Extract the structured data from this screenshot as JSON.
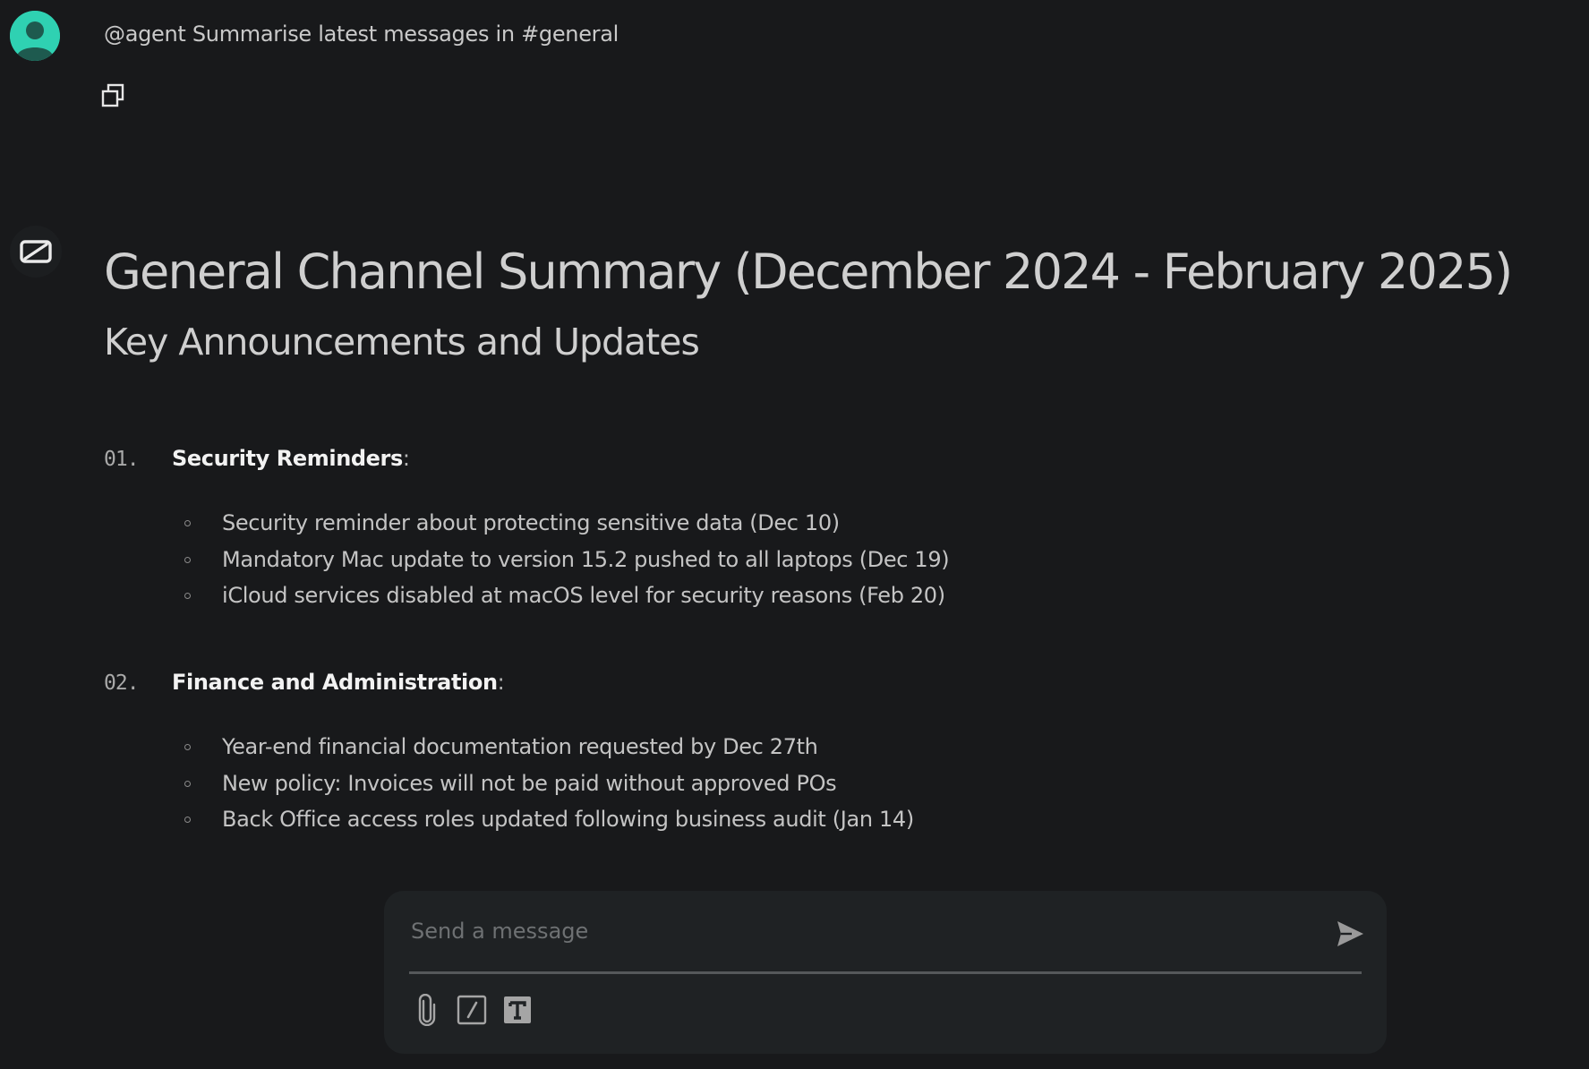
{
  "user_message": {
    "text": "@agent Summarise latest messages in #general"
  },
  "response": {
    "title": "General Channel Summary (December 2024 - February 2025)",
    "subtitle": "Key Announcements and Updates",
    "sections": [
      {
        "number": "01.",
        "title": "Security Reminders",
        "colon": ":",
        "items": [
          "Security reminder about protecting sensitive data (Dec 10)",
          "Mandatory Mac update to version 15.2 pushed to all laptops (Dec 19)",
          "iCloud services disabled at macOS level for security reasons (Feb 20)"
        ]
      },
      {
        "number": "02.",
        "title": "Finance and Administration",
        "colon": ":",
        "items": [
          "Year-end financial documentation requested by Dec 27th",
          "New policy: Invoices will not be paid without approved POs",
          "Back Office access roles updated following business audit (Jan 14)"
        ]
      }
    ]
  },
  "composer": {
    "placeholder": "Send a message",
    "value": ""
  },
  "icons": {
    "user_avatar": "user-avatar-icon",
    "copy": "copy-icon",
    "agent_logo": "agent-logo-icon",
    "send": "send-icon",
    "attach": "paperclip-icon",
    "slash_command": "slash-command-icon",
    "text_format": "text-format-icon"
  },
  "colors": {
    "background": "#18191b",
    "avatar_teal": "#2fd1b2",
    "composer_bg": "#1f2224"
  }
}
